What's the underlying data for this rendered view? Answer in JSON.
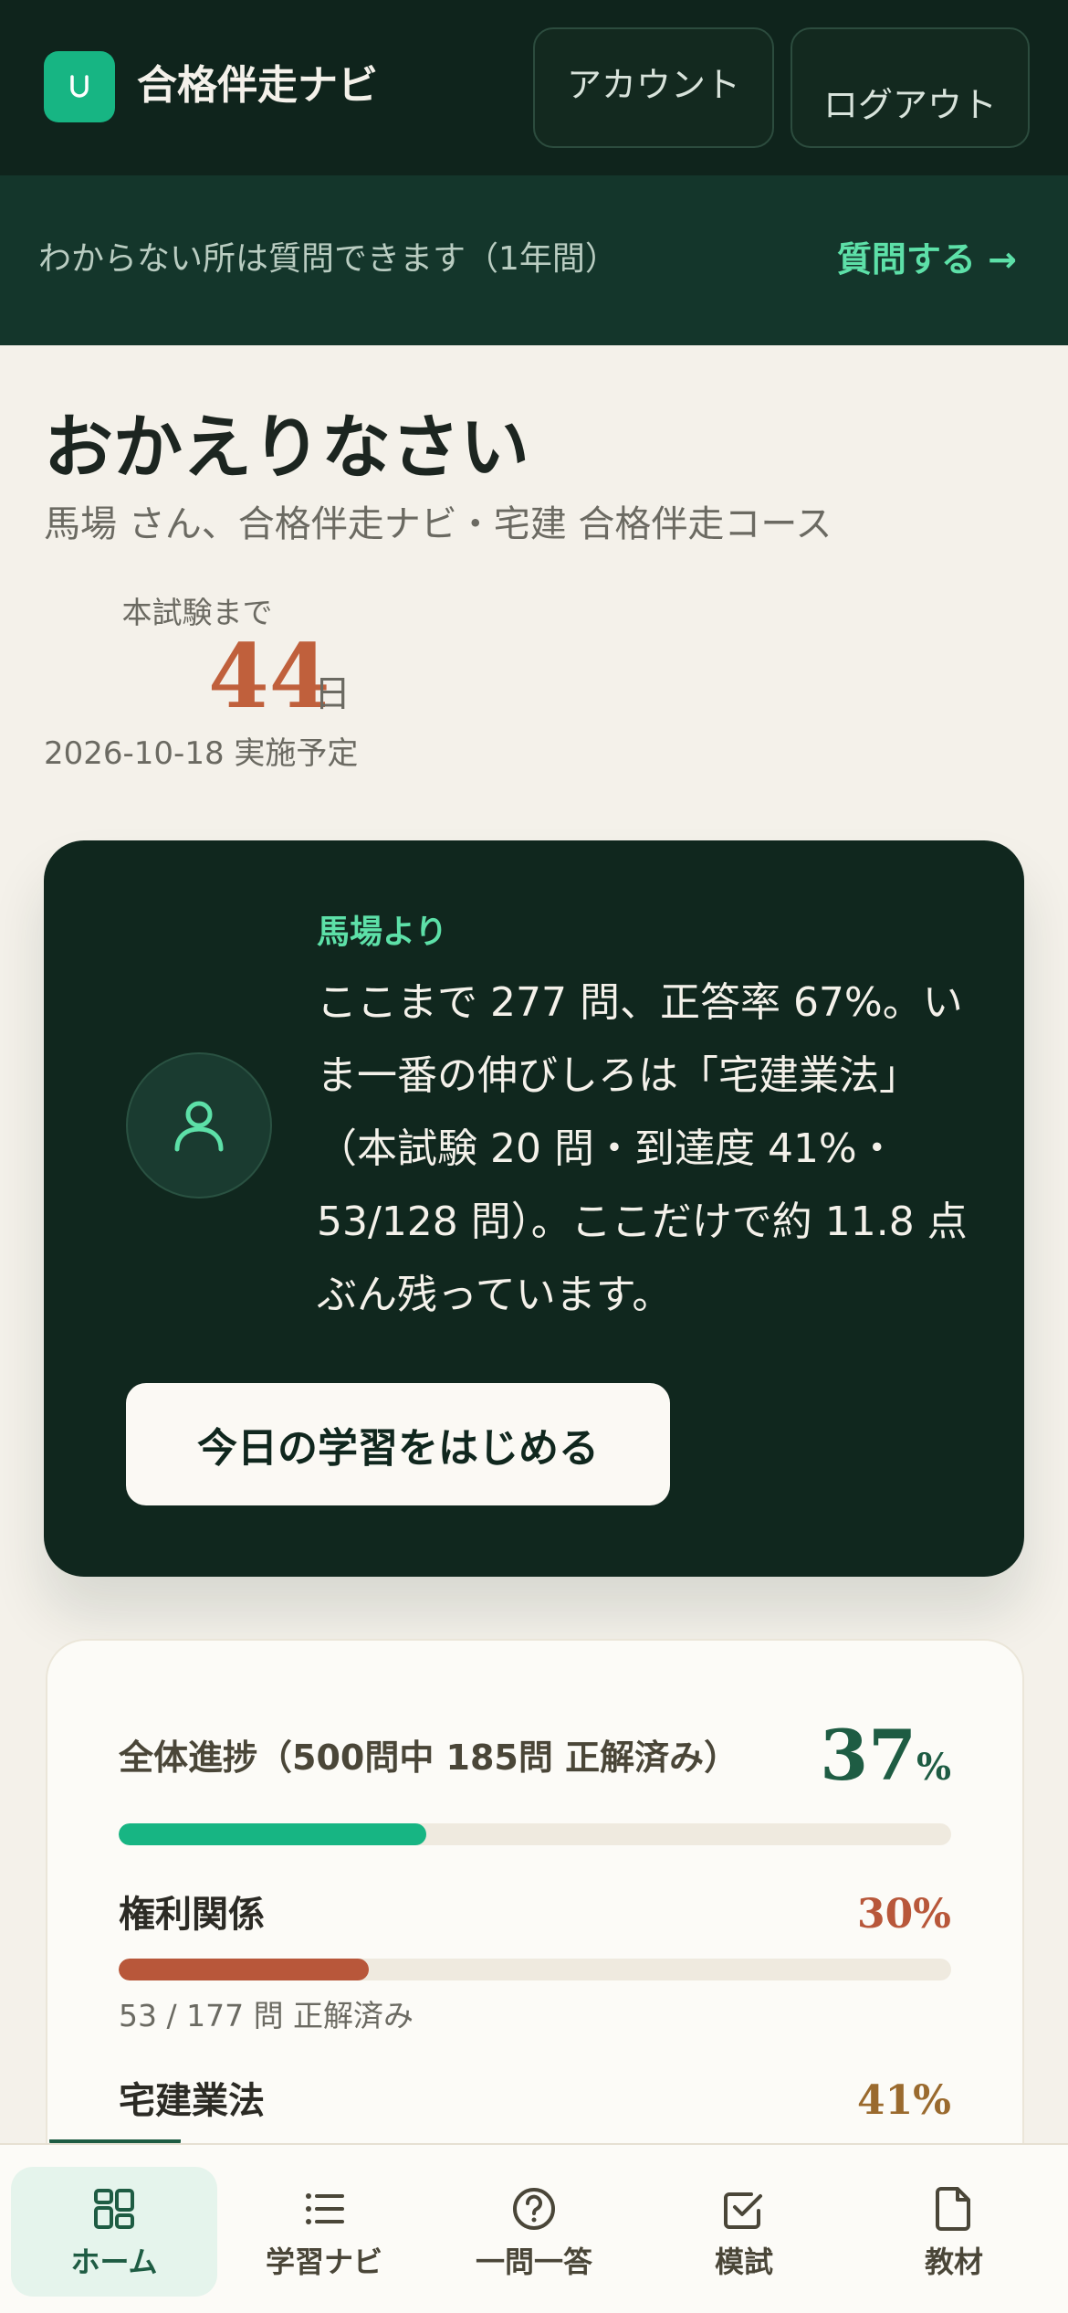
{
  "header": {
    "brand": "合格伴走ナビ",
    "account_label": "アカウント",
    "logout_label": "ログアウト"
  },
  "banner": {
    "text": "わからない所は質問できます（1年間）",
    "link_label": "質問する →"
  },
  "greeting": {
    "title": "おかえりなさい",
    "subtitle": "馬場 さん、合格伴走ナビ・宅建 合格伴走コース"
  },
  "countdown": {
    "label": "本試験まで",
    "days": "44",
    "unit": "日",
    "date_note": "2026-10-18 実施予定"
  },
  "coach": {
    "from": "馬場より",
    "message": "ここまで 277 問、正答率 67%。いま一番の伸びしろは「宅建業法」（本試験 20 問・到達度 41%・53/128 問）。ここだけで約 11.8 点ぶん残っています。",
    "start_label": "今日の学習をはじめる"
  },
  "progress": {
    "overall_label": "全体進捗（500問中 185問 正解済み）",
    "overall_value": "37",
    "overall_unit": "%",
    "overall_fraction": 0.37,
    "subjects": [
      {
        "name": "権利関係",
        "percent": "30%",
        "fraction": 0.3,
        "note": "53 / 177 問 正解済み",
        "color": "#b8573a"
      },
      {
        "name": "宅建業法",
        "percent": "41%",
        "fraction": 0.41,
        "note": "",
        "color": "#9a6a2e"
      }
    ]
  },
  "colors": {
    "brand_green": "#17b583",
    "dark_green": "#0f241c",
    "accent_mint": "#5de0a8",
    "countdown_orange": "#c0603c"
  },
  "nav": {
    "items": [
      {
        "label": "ホーム",
        "icon": "grid-icon",
        "active": true
      },
      {
        "label": "学習ナビ",
        "icon": "list-icon",
        "active": false
      },
      {
        "label": "一問一答",
        "icon": "question-icon",
        "active": false
      },
      {
        "label": "模試",
        "icon": "check-square-icon",
        "active": false
      },
      {
        "label": "教材",
        "icon": "file-icon",
        "active": false
      }
    ]
  }
}
